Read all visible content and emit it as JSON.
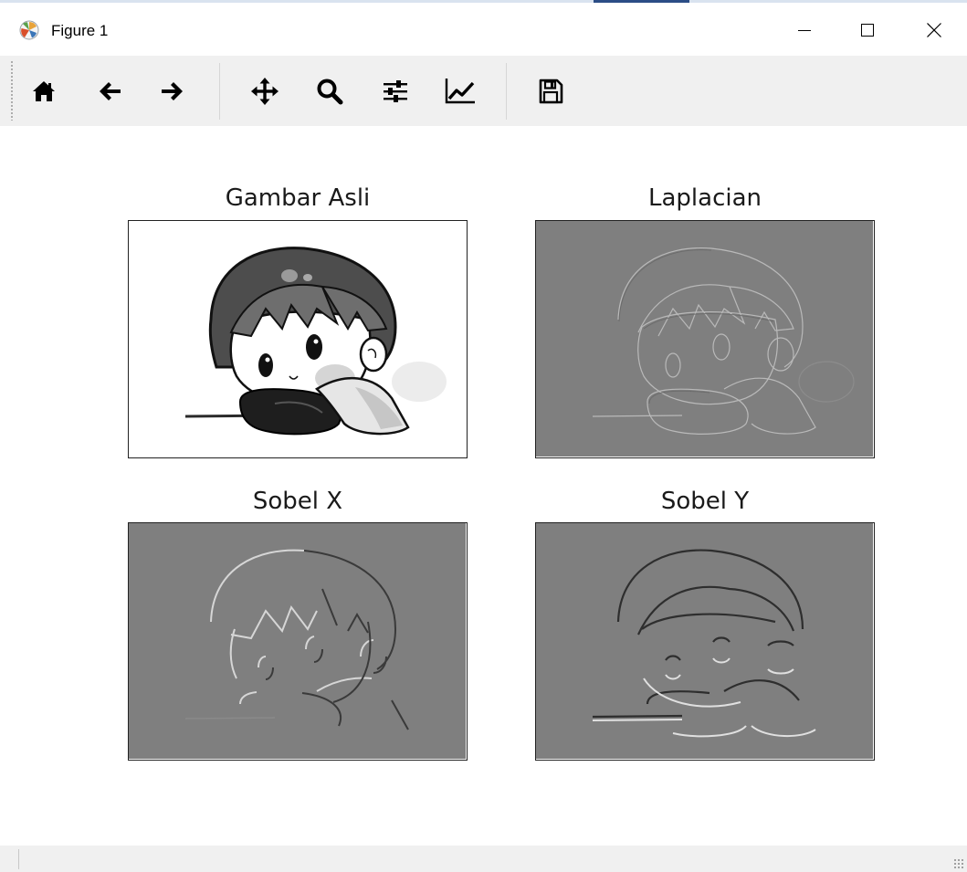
{
  "window": {
    "title": "Figure 1",
    "controls": [
      "minimize",
      "maximize",
      "close"
    ]
  },
  "toolbar": {
    "tools": [
      {
        "name": "home",
        "icon": "home-icon"
      },
      {
        "name": "back",
        "icon": "arrow-left-icon"
      },
      {
        "name": "forward",
        "icon": "arrow-right-icon"
      },
      {
        "name": "pan",
        "icon": "move-icon"
      },
      {
        "name": "zoom",
        "icon": "magnifier-icon"
      },
      {
        "name": "configure-subplots",
        "icon": "sliders-icon"
      },
      {
        "name": "edit-axes",
        "icon": "line-chart-icon"
      },
      {
        "name": "save",
        "icon": "floppy-disk-icon"
      }
    ]
  },
  "figure": {
    "subplots": [
      {
        "title": "Gambar Asli"
      },
      {
        "title": "Laplacian"
      },
      {
        "title": "Sobel X"
      },
      {
        "title": "Sobel Y"
      }
    ]
  },
  "colors": {
    "toolbar_bg": "#f0f0f0",
    "edge_map_gray": "#7f7f7f",
    "frame": "#222222"
  }
}
